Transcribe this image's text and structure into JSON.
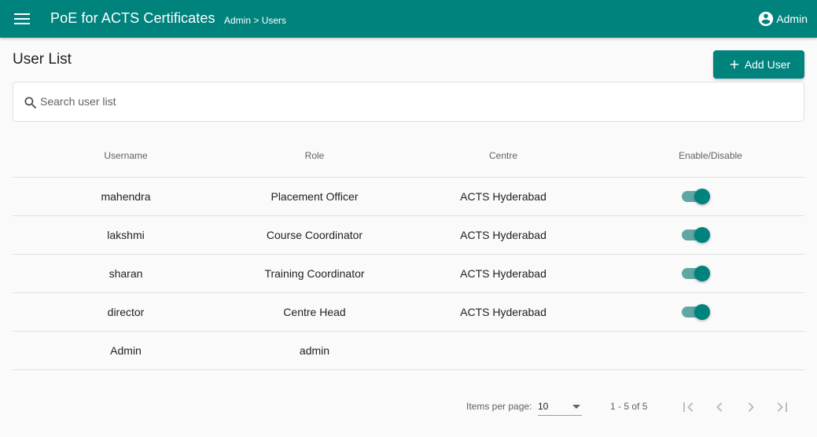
{
  "header": {
    "title": "PoE for ACTS Certificates",
    "breadcrumb": "Admin > Users",
    "user_label": "Admin",
    "accent_color": "#00837d"
  },
  "page": {
    "title": "User List",
    "add_button_label": "Add User"
  },
  "search": {
    "placeholder": "Search user list",
    "value": ""
  },
  "table": {
    "columns": [
      "Username",
      "Role",
      "Centre",
      "Enable/Disable"
    ],
    "rows": [
      {
        "username": "mahendra",
        "role": "Placement Officer",
        "centre": "ACTS Hyderabad",
        "enabled": true
      },
      {
        "username": "lakshmi",
        "role": "Course Coordinator",
        "centre": "ACTS Hyderabad",
        "enabled": true
      },
      {
        "username": "sharan",
        "role": "Training Coordinator",
        "centre": "ACTS Hyderabad",
        "enabled": true
      },
      {
        "username": "director",
        "role": "Centre Head",
        "centre": "ACTS Hyderabad",
        "enabled": true
      },
      {
        "username": "Admin",
        "role": "admin",
        "centre": "",
        "enabled": null
      }
    ]
  },
  "paginator": {
    "items_per_page_label": "Items per page:",
    "page_size": "10",
    "range_label": "1 - 5 of 5"
  },
  "icons": {
    "menu": "menu-icon",
    "account": "account-circle-icon",
    "add": "plus-icon",
    "search": "search-icon",
    "first": "first-page-icon",
    "prev": "chevron-left-icon",
    "next": "chevron-right-icon",
    "last": "last-page-icon"
  }
}
